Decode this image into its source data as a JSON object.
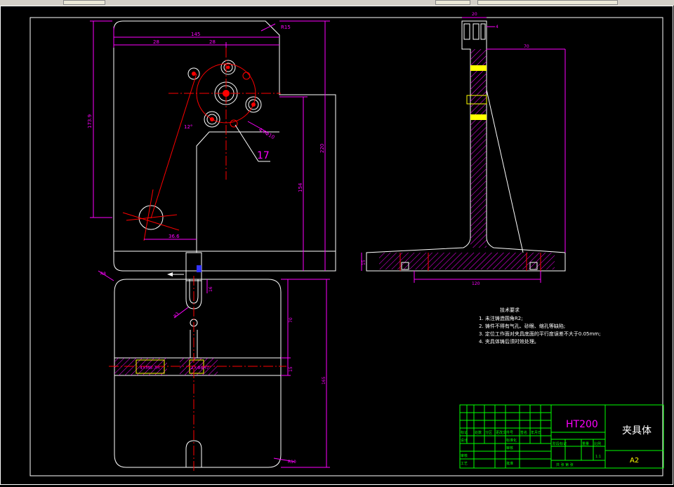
{
  "drawing": {
    "title_block": {
      "material": "HT200",
      "part_name": "夹具体",
      "sheet_size": "A2",
      "scale": "1:1",
      "row_headers": [
        "标记",
        "处数",
        "分区",
        "更改文件号",
        "签名",
        "年月日"
      ],
      "design_label": "设计",
      "standardize_label": "标准化",
      "stage_label": "阶段标记",
      "weight_label": "重量",
      "ratio_label": "比例",
      "review_label": "审核",
      "craft_label": "工艺",
      "approve_label": "批准",
      "process_label": "审核",
      "sheets_text": "共  张  第  张"
    },
    "notes": {
      "heading": "技术要求",
      "items": [
        "1. 未注铸造圆角R2;",
        "2. 铸件不得有气孔、砂眼、缩孔等缺陷;",
        "3. 定位工作面对夹具底面的平行度误差不大于0.05mm;",
        "4. 夹具体铸后须时效处理。"
      ]
    },
    "callouts": {
      "part_17": "17"
    },
    "front_view_dims": {
      "width_total": "145",
      "left_offset": "28",
      "right_offset": "28",
      "height_left": "173.9",
      "height_right": "220",
      "inner_height": "154",
      "small_offset": "36.6",
      "angle": "12°",
      "corner_radius": "R15",
      "hole_label": "4×Φ10"
    },
    "top_view_dims": {
      "slot": "16",
      "height_a": "70",
      "height_b": "15",
      "height_total": "165",
      "corner_radius_tl": "R8",
      "corner_radius_br": "R10",
      "hole_left": "4×M8-7H",
      "hole_right": "2×Φ8H7",
      "angle": "R3"
    },
    "side_view_dims": {
      "top_width": "20",
      "top_small": "4",
      "top_offset": "70",
      "base_height": "15",
      "base_length": "120"
    }
  },
  "colors": {
    "background": "#000000",
    "outline": "#ffffff",
    "dimension": "#ff00ff",
    "center_line": "#ff0000",
    "hatch": "#ff00ff",
    "highlight": "#ffff00",
    "table": "#00ff00",
    "material_text": "#ff00ff"
  }
}
